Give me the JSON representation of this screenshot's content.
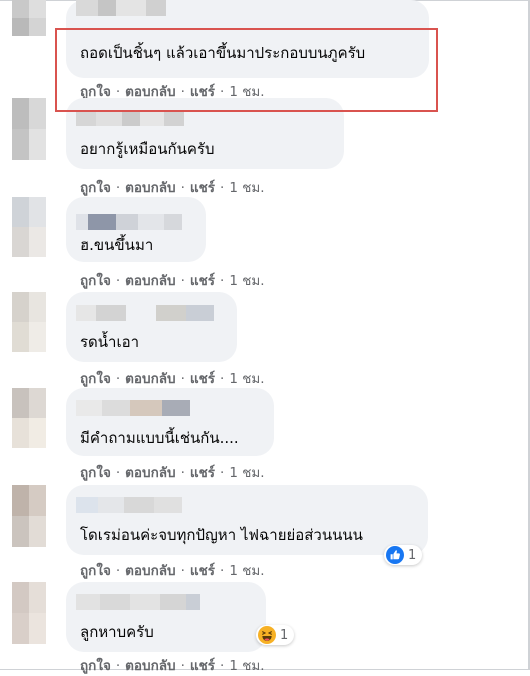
{
  "action_labels": {
    "like": "ถูกใจ",
    "reply": "ตอบกลับ",
    "share": "แชร์",
    "separator": "·"
  },
  "comments": [
    {
      "text": "ถอดเป็นชิ้นๆ แล้วเอาขึ้นมาประกอบบนภูครับ",
      "time": "1 ชม.",
      "highlighted": true
    },
    {
      "text": "อยากรู้เหมือนกันครับ",
      "time": "1 ชม."
    },
    {
      "text": "ฮ.ขนขึ้นมา",
      "time": "1 ชม."
    },
    {
      "text": "รดน้ำเอา",
      "time": "1 ชม."
    },
    {
      "text": "มีคำถามแบบนี้เช่นกัน....",
      "time": "1 ชม."
    },
    {
      "text": "โดเรม่อนค่ะจบทุกปัญหา ไฟฉายย่อส่วนนนน",
      "time": "1 ชม.",
      "reaction": {
        "icon": "like-reaction-icon",
        "count": "1"
      }
    },
    {
      "text": "ลูกหาบครับ",
      "time": "1 ชม.",
      "reaction": {
        "icon": "haha-reaction-icon",
        "count": "1"
      }
    }
  ],
  "colors": {
    "highlight_border": "#d9534f",
    "bubble_bg": "#f0f2f5",
    "meta_text": "#65676b",
    "like_blue": "#1877f2",
    "haha_yellow": "#f7b125"
  }
}
